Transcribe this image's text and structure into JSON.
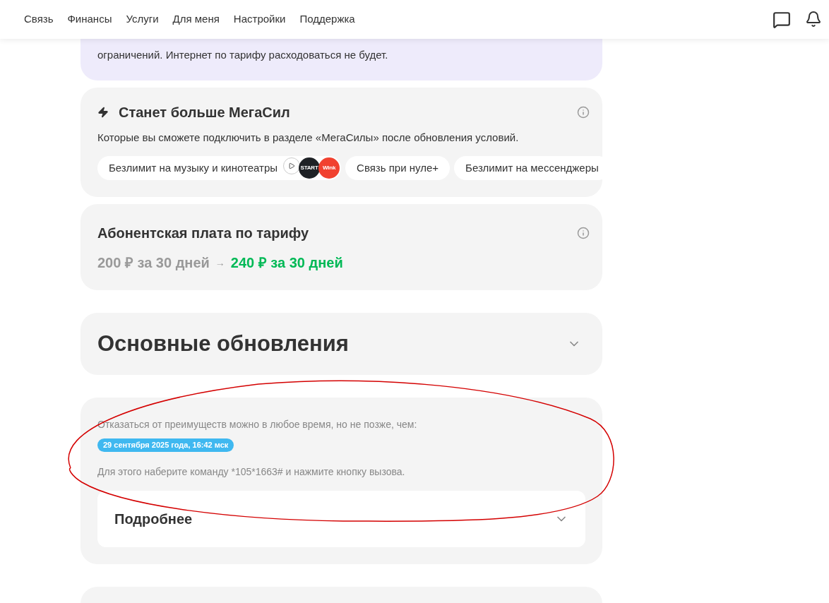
{
  "header": {
    "nav": [
      {
        "label": "Связь"
      },
      {
        "label": "Финансы"
      },
      {
        "label": "Услуги"
      },
      {
        "label": "Для меня"
      },
      {
        "label": "Настройки"
      },
      {
        "label": "Поддержка"
      }
    ]
  },
  "intro_card": {
    "text": "ограничений. Интернет по тарифу расходоваться не будет."
  },
  "megasila_card": {
    "title": "Станет больше МегаСил",
    "description": "Которые вы сможете подключить в разделе «МегаСилы» после обновления условий.",
    "chips": [
      {
        "label": "Безлимит на музыку и кинотеатры",
        "logos": [
          {
            "kind": "play"
          },
          {
            "kind": "text",
            "label": "START",
            "color": "#1f2226"
          },
          {
            "kind": "text",
            "label": "Wink",
            "color": "#f1412f"
          }
        ]
      },
      {
        "label": "Связь при нуле+"
      },
      {
        "label": "Безлимит на мессенджеры"
      }
    ]
  },
  "fee_card": {
    "title": "Абонентская плата по тарифу",
    "old_price": "200 ₽ за 30 дней",
    "arrow": "→",
    "new_price": "240 ₽ за 30 дней"
  },
  "updates": {
    "title": "Основные обновления",
    "expanded": false
  },
  "cancel_card": {
    "text": "Отказаться от преимуществ можно в любое время, но не позже, чем:",
    "deadline": "29 сентября 2025 года, 16:42 мск",
    "instruction": "Для этого наберите команду *105*1663# и нажмите кнопку вызова.",
    "details": {
      "title": "Подробнее",
      "expanded": false
    }
  }
}
